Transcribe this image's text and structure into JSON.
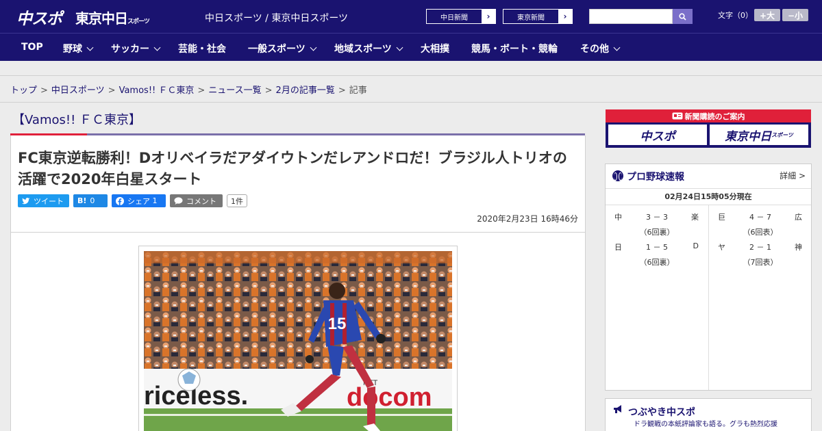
{
  "header": {
    "logo_chuspo": "中スポ",
    "logo_tokyo": "東京中日",
    "logo_tokyo_small": "スポーツ",
    "site_links": "中日スポーツ / 東京中日スポーツ",
    "ext_links": [
      "中日新聞",
      "東京新聞"
    ],
    "search_placeholder": "",
    "fontsize_label": "文字（0）",
    "font_larger": "+大",
    "font_smaller": "−小"
  },
  "nav": [
    {
      "label": "TOP",
      "dropdown": false
    },
    {
      "label": "野球",
      "dropdown": true
    },
    {
      "label": "サッカー",
      "dropdown": true
    },
    {
      "label": "芸能・社会",
      "dropdown": false
    },
    {
      "label": "一般スポーツ",
      "dropdown": true
    },
    {
      "label": "地域スポーツ",
      "dropdown": true
    },
    {
      "label": "大相撲",
      "dropdown": false
    },
    {
      "label": "競馬・ボート・競輪",
      "dropdown": false
    },
    {
      "label": "その他",
      "dropdown": true
    }
  ],
  "breadcrumb": [
    "トップ",
    "中日スポーツ",
    "Vamos!! ＦＣ東京",
    "ニュース一覧",
    "2月の記事一覧",
    "記事"
  ],
  "category_title": "【Vamos!! ＦＣ東京】",
  "article": {
    "headline": "FC東京逆転勝利！Dオリベイラだアダイウトンだレアンドロだ！ブラジル人トリオの活躍で2020年白星スタート",
    "share": {
      "tweet": "ツイート",
      "hatena_icon": "B!",
      "hatena_count": "0",
      "facebook": "シェア",
      "facebook_count": "1",
      "comment": "コメント",
      "comment_count": "1件"
    },
    "date": "2020年2月23日 16時46分",
    "photo": {
      "banner_left": "riceless.",
      "banner_right": "docom",
      "banner_small": "NTT",
      "jersey_number": "15"
    }
  },
  "sidebar": {
    "ad_title": "新聞購読のご案内",
    "ad_buttons": [
      "中スポ",
      "東京中日"
    ],
    "ad_button_small": "スポーツ",
    "scores": {
      "title": "プロ野球速報",
      "detail": "詳細 >",
      "time": "02月24日15時05分現在",
      "games_left": [
        {
          "home": "中",
          "score": "3 － 3",
          "away": "楽",
          "inning": "（6回裏）"
        },
        {
          "home": "日",
          "score": "1 － 5",
          "away": "D",
          "inning": "（6回裏）"
        }
      ],
      "games_right": [
        {
          "home": "巨",
          "score": "4 － 7",
          "away": "広",
          "inning": "（6回表）"
        },
        {
          "home": "ヤ",
          "score": "2 － 1",
          "away": "神",
          "inning": "（7回表）"
        }
      ]
    },
    "tweet": {
      "title": "つぶやき中スポ",
      "subtitle": "ドラ観戦の本紙評論家も語る。グラも熱烈応援"
    }
  },
  "colors": {
    "brand_navy": "#1a1370",
    "accent_red": "#e0203a",
    "twitter": "#1d9bf0",
    "hatena": "#1e88e5",
    "facebook": "#1877f2",
    "comment": "#777777"
  }
}
